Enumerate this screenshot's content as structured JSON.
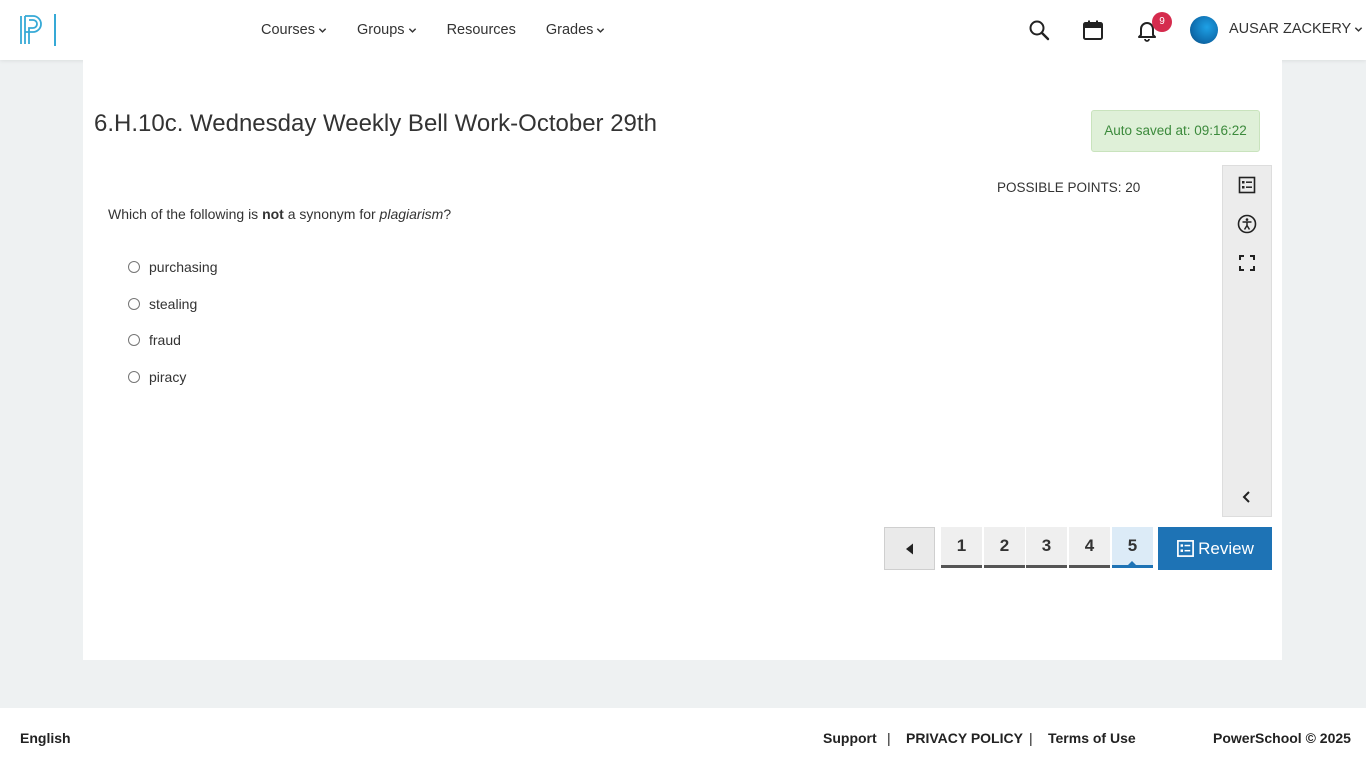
{
  "header": {
    "nav": [
      {
        "label": "Courses",
        "has_menu": true
      },
      {
        "label": "Groups",
        "has_menu": true
      },
      {
        "label": "Resources",
        "has_menu": false
      },
      {
        "label": "Grades",
        "has_menu": true
      }
    ],
    "notification_count": "9",
    "user_name": "AUSAR ZACKERY",
    "icons": [
      "search-icon",
      "calendar-icon",
      "bell-icon"
    ]
  },
  "assessment": {
    "title": "6.H.10c. Wednesday Weekly Bell Work-October 29th",
    "autosave": "Auto saved at: 09:16:22",
    "possible_points": "POSSIBLE POINTS: 20",
    "question": {
      "prefix": "Which of the following is ",
      "bold": "not",
      "middle": " a synonym for ",
      "italic": "plagiarism",
      "suffix": "?"
    },
    "options": [
      "purchasing",
      "stealing",
      "fraud",
      "piracy"
    ]
  },
  "toolbar": {
    "tools": [
      "question-list-icon",
      "accessibility-icon",
      "fullscreen-icon",
      "collapse-icon"
    ]
  },
  "pagination": {
    "pages": [
      "1",
      "2",
      "3",
      "4",
      "5"
    ],
    "current_page": "5",
    "review_label": "Review"
  },
  "footer": {
    "language": "English",
    "support": "Support",
    "privacy": "PRIVACY POLICY",
    "terms": "Terms of Use",
    "separator": "|",
    "copyright": "PowerSchool © 2025"
  },
  "colors": {
    "brand_blue": "#1e73b5",
    "logo_blue": "#36a9d6",
    "badge_red": "#d52b4d",
    "autosave_bg": "#dff0d8",
    "autosave_text": "#3c8a3c"
  }
}
